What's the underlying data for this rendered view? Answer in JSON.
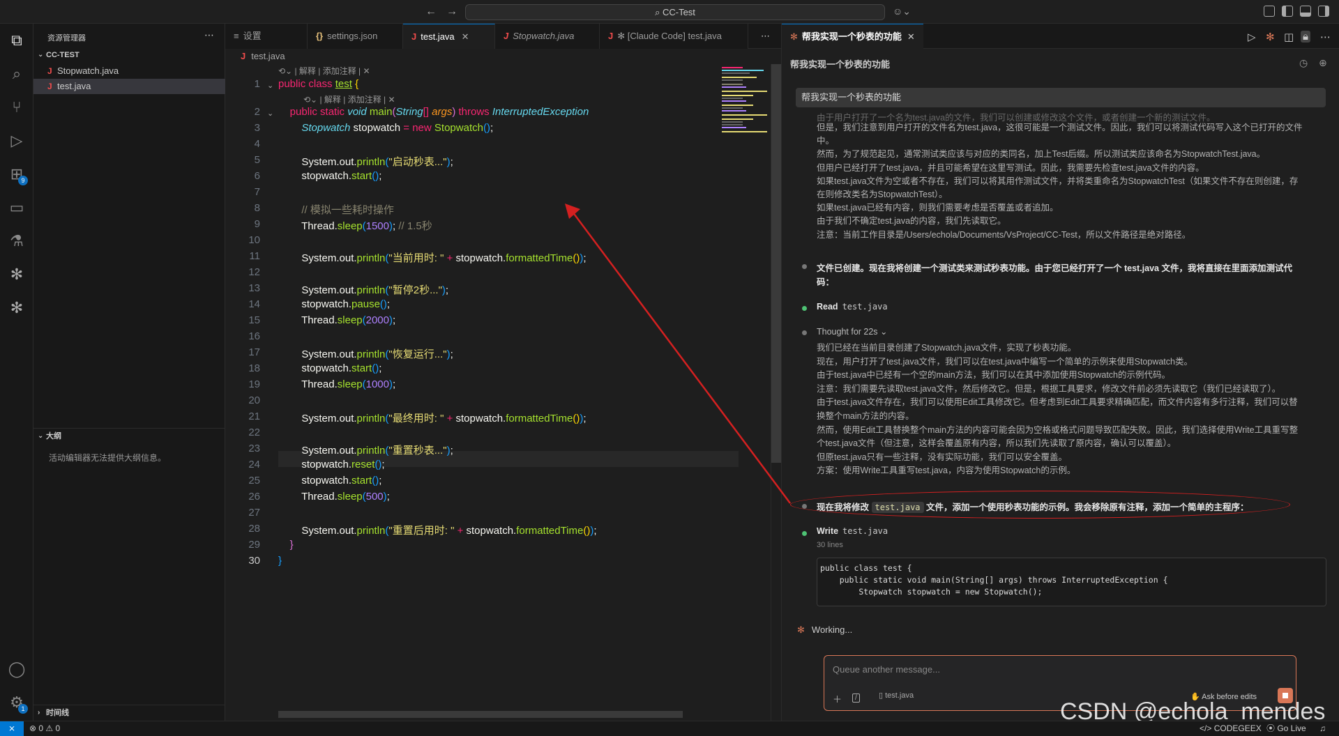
{
  "title_bar": {
    "search_text": "CC-Test",
    "back_icon": "arrow-left-icon",
    "forward_icon": "arrow-right-icon"
  },
  "sidebar": {
    "title": "资源管理器",
    "project": "CC-TEST",
    "files": [
      "Stopwatch.java",
      "test.java"
    ],
    "outline_title": "大纲",
    "outline_empty": "活动编辑器无法提供大纲信息。",
    "timeline_title": "时间线"
  },
  "activity_badges": {
    "extensions": "9",
    "settings": "1"
  },
  "editor": {
    "tabs": [
      {
        "icon": "≡",
        "label": "设置"
      },
      {
        "icon": "{}",
        "label": "settings.json"
      },
      {
        "icon": "J",
        "label": "test.java"
      },
      {
        "icon": "J",
        "label": "Stopwatch.java"
      },
      {
        "icon": "J",
        "label": "✻ [Claude Code] test.java"
      }
    ],
    "breadcrumb": "test.java",
    "codelens": "| 解释 | 添加注释 | ✕",
    "line_numbers": [
      "1",
      "2",
      "3",
      "4",
      "5",
      "6",
      "7",
      "8",
      "9",
      "10",
      "11",
      "12",
      "13",
      "14",
      "15",
      "16",
      "17",
      "18",
      "19",
      "20",
      "21",
      "22",
      "23",
      "24",
      "25",
      "26",
      "27",
      "28",
      "29",
      "30"
    ]
  },
  "panel": {
    "tab_title": "帮我实现一个秒表的功能",
    "chat_title": "帮我实现一个秒表的功能",
    "user_message": "帮我实现一个秒表的功能",
    "thinking_lines_1": [
      "由于用户打开了一个名为test.java的文件，我们可以创建或修改这个文件，或者创建一个新的测试文件。",
      "但是，我们注意到用户打开的文件名为test.java，这很可能是一个测试文件。因此，我们可以将测试代码写入这个已打开的文件",
      "中。",
      "然而，为了规范起见，通常测试类应该与对应的类同名，加上Test后缀。所以测试类应该命名为StopwatchTest.java。",
      "但用户已经打开了test.java，并且可能希望在这里写测试。因此，我需要先检查test.java文件的内容。",
      "如果test.java文件为空或者不存在，我们可以将其用作测试文件，并将类重命名为StopwatchTest（如果文件不存在则创建，存",
      "在则修改类名为StopwatchTest）。",
      "如果test.java已经有内容，则我们需要考虑是否覆盖或者追加。",
      "由于我们不确定test.java的内容，我们先读取它。",
      "注意：当前工作目录是/Users/echola/Documents/VsProject/CC-Test，所以文件路径是绝对路径。"
    ],
    "msg_created_1": "文件已创建。现在我将创建一个测试类来测试秒表功能。由于您已经打开了一个 test.java 文件，我将直接在里面添加测试代",
    "msg_created_2": "码：",
    "read_tool": "Read",
    "read_arg": "test.java",
    "thought_label": "Thought for 22s",
    "thinking_lines_2": [
      "我们已经在当前目录创建了Stopwatch.java文件，实现了秒表功能。",
      "现在，用户打开了test.java文件，我们可以在test.java中编写一个简单的示例来使用Stopwatch类。",
      "由于test.java中已经有一个空的main方法，我们可以在其中添加使用Stopwatch的示例代码。",
      "注意：我们需要先读取test.java文件，然后修改它。但是，根据工具要求，修改文件前必须先读取它（我们已经读取了）。",
      "由于test.java文件存在，我们可以使用Edit工具修改它。但考虑到Edit工具要求精确匹配，而文件内容有多行注释，我们可以替",
      "换整个main方法的内容。",
      "然而，使用Edit工具替换整个main方法的内容可能会因为空格或格式问题导致匹配失败。因此，我们选择使用Write工具重写整",
      "个test.java文件（但注意，这样会覆盖原有内容，所以我们先读取了原内容，确认可以覆盖）。",
      "但原test.java只有一些注释，没有实际功能，我们可以安全覆盖。",
      "方案：使用Write工具重写test.java，内容为使用Stopwatch的示例。"
    ],
    "msg_modify_pre": "现在我将修改",
    "msg_modify_code": "test.java",
    "msg_modify_post": "文件，添加一个使用秒表功能的示例。我会移除原有注释，添加一个简单的主程序：",
    "write_tool": "Write",
    "write_arg": "test.java",
    "write_lines": "30 lines",
    "code_preview": [
      "public class test {",
      "    public static void main(String[] args) throws InterruptedException {",
      "        Stopwatch stopwatch = new Stopwatch();"
    ],
    "working": "Working...",
    "input_placeholder": "Queue another message...",
    "file_chip": "test.java",
    "ask_before_edits": "Ask before edits"
  },
  "status_bar": {
    "problems": "⊗ 0 ⚠ 0",
    "codegeex": "CODEGEEX",
    "go_live": "Go Live"
  },
  "watermark": "CSDN @echola_mendes",
  "colors": {
    "accent": "#0078d4",
    "claude": "#d97757",
    "annotation_red": "#d42020"
  }
}
